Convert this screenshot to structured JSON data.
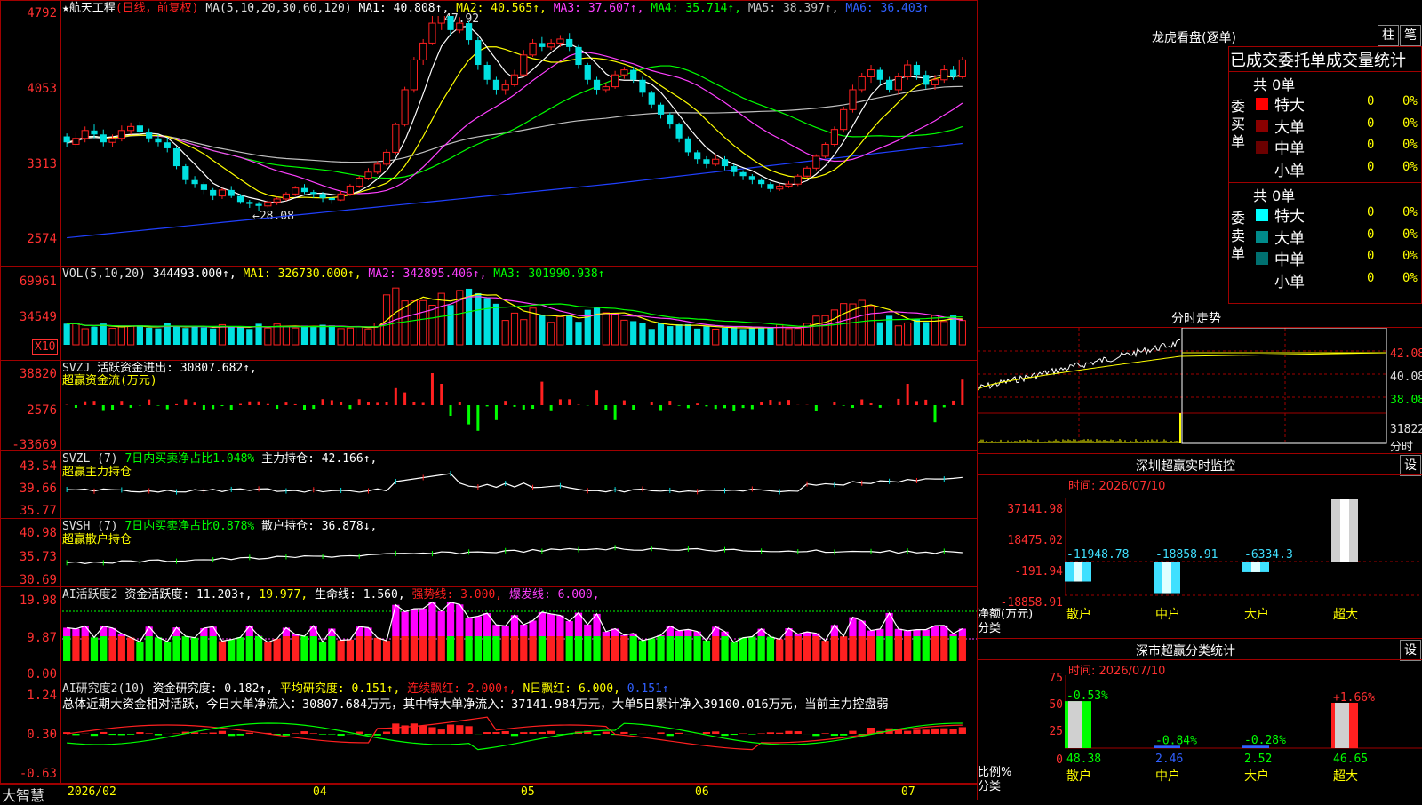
{
  "stock": {
    "star": "★",
    "name": "航天工程",
    "mode": "(日线，前复权)",
    "ma_label": "MA(5,10,20,30,60,120)",
    "ma1": "MA1: 40.808↑,",
    "ma2": "MA2: 40.565↑,",
    "ma3": "MA3: 37.607↑,",
    "ma4": "MA4: 35.714↑,",
    "ma5": "MA5: 38.397↑,",
    "ma6": "MA6: 36.403↑",
    "high_mark": "47.92",
    "low_mark": "←28.08",
    "y_labels": [
      "4792",
      "4053",
      "3313",
      "2574"
    ]
  },
  "vol": {
    "label": "VOL(5,10,20)",
    "value": "344493.000↑,",
    "ma1": "MA1: 326730.000↑,",
    "ma2": "MA2: 342895.406↑,",
    "ma3": "MA3: 301990.938↑",
    "y_labels": [
      "69961",
      "34549"
    ],
    "unit": "X10"
  },
  "svzj": {
    "label": "SVZJ",
    "text": "活跃资金进出: 30807.682↑,",
    "subtitle": "超赢资金流(万元)",
    "y_labels": [
      "38820",
      "2576",
      "-33669"
    ]
  },
  "svzl": {
    "label": "SVZL (7)",
    "ratio": "7日内买卖净占比1.048%",
    "hold": "主力持仓: 42.166↑,",
    "subtitle": "超赢主力持仓",
    "y_labels": [
      "43.54",
      "39.66",
      "35.77"
    ]
  },
  "svsh": {
    "label": "SVSH (7)",
    "ratio": "7日内买卖净占比0.878%",
    "hold": "散户持仓: 36.878↓,",
    "subtitle": "超赢散户持仓",
    "y_labels": [
      "40.98",
      "35.73",
      "30.69"
    ]
  },
  "ai1": {
    "label": "AI活跃度2",
    "text": "资金活跃度: 11.203↑,",
    "v2": "19.977,",
    "life": "生命线: 1.560,",
    "strong": "强势线: 3.000,",
    "burst": "爆发线: 6.000,",
    "y_labels": [
      "19.98",
      "9.87",
      "0.00"
    ]
  },
  "ai2": {
    "label": "AI研究度2(10)",
    "text": "资金研究度: 0.182↑,",
    "avg": "平均研究度: 0.151↑,",
    "lx": "连续飘红: 2.000↑,",
    "nday": "N日飘红: 6.000,",
    "tail": "0.151↑",
    "summary": "总体近期大资金相对活跃，今日大单净流入：30807.684万元，其中特大单净流入：37141.984万元，大单5日累计净入39100.016万元，当前主力控盘弱",
    "y_labels": [
      "1.24",
      "0.30",
      "-0.63"
    ]
  },
  "footer": {
    "brand": "大智慧",
    "dates": [
      "2026/02",
      "04",
      "05",
      "06",
      "07"
    ]
  },
  "right": {
    "title": "龙虎看盘(逐单)",
    "btn1": "柱",
    "btn2": "笔",
    "table_header": "已成交委托单成交量统计",
    "buy_title": "委买单",
    "sell_title": "委卖单",
    "buy_total": "共 0单",
    "sell_total": "共 0单",
    "buy_rows": [
      {
        "name": "特大",
        "count": "0",
        "pct": "0%",
        "color": "#ff0000"
      },
      {
        "name": "大单",
        "count": "0",
        "pct": "0%",
        "color": "#8b0000"
      },
      {
        "name": "中单",
        "count": "0",
        "pct": "0%",
        "color": "#6b0000"
      },
      {
        "name": "小单",
        "count": "0",
        "pct": "0%",
        "color": "#000000"
      }
    ],
    "sell_rows": [
      {
        "name": "特大",
        "count": "0",
        "pct": "0%",
        "color": "#00ffff"
      },
      {
        "name": "大单",
        "count": "0",
        "pct": "0%",
        "color": "#008b8b"
      },
      {
        "name": "中单",
        "count": "0",
        "pct": "0%",
        "color": "#007070"
      },
      {
        "name": "小单",
        "count": "0",
        "pct": "0%",
        "color": "#000000"
      }
    ],
    "intraday_title": "分时走势",
    "intraday_y": [
      "42.08",
      "40.08",
      "38.08",
      "31822"
    ],
    "intraday_unit": "分时",
    "monitor_title": "深圳超赢实时监控",
    "monitor_btn": "设",
    "monitor_time": "时间: 2026/07/10",
    "monitor_y": [
      "37141.98",
      "18475.02",
      "-191.94",
      "-18858.91"
    ],
    "monitor_axis": [
      "净额(万元)",
      "分类"
    ],
    "monitor_cats": [
      "散户",
      "中户",
      "大户",
      "超大"
    ],
    "monitor_vals": [
      "-11948.78",
      "-18858.91",
      "-6334.3",
      "37141.98"
    ],
    "class_title": "深市超赢分类统计",
    "class_btn": "设",
    "class_time": "时间: 2026/07/10",
    "class_y": [
      "75",
      "50",
      "25",
      "0"
    ],
    "class_axis": [
      "比例%",
      "分类"
    ],
    "class_cats": [
      "散户",
      "中户",
      "大户",
      "超大"
    ],
    "class_top": [
      "-0.53%",
      "-0.84%",
      "-0.28%",
      "+1.66%"
    ],
    "class_vals": [
      "48.38",
      "2.46",
      "2.52",
      "46.65"
    ]
  },
  "chart_data": {
    "type": "candlestick",
    "candles": [
      [
        3580,
        3520,
        3610,
        3470
      ],
      [
        3500,
        3560,
        3620,
        3460
      ],
      [
        3560,
        3640,
        3680,
        3520
      ],
      [
        3640,
        3600,
        3700,
        3560
      ],
      [
        3600,
        3520,
        3650,
        3480
      ],
      [
        3520,
        3560,
        3600,
        3470
      ],
      [
        3560,
        3640,
        3690,
        3530
      ],
      [
        3640,
        3680,
        3720,
        3600
      ],
      [
        3690,
        3620,
        3730,
        3580
      ],
      [
        3620,
        3560,
        3660,
        3520
      ],
      [
        3560,
        3520,
        3600,
        3480
      ],
      [
        3520,
        3460,
        3570,
        3420
      ],
      [
        3460,
        3280,
        3480,
        3250
      ],
      [
        3280,
        3140,
        3300,
        3100
      ],
      [
        3140,
        3100,
        3180,
        3060
      ],
      [
        3100,
        3040,
        3120,
        3000
      ],
      [
        3040,
        2980,
        3060,
        2940
      ],
      [
        2980,
        3040,
        3060,
        2950
      ],
      [
        3040,
        2980,
        3080,
        2960
      ],
      [
        2980,
        2920,
        3000,
        2900
      ],
      [
        2920,
        2900,
        2940,
        2860
      ],
      [
        2900,
        2880,
        2920,
        2830
      ],
      [
        2880,
        2920,
        2940,
        2860
      ],
      [
        2920,
        2950,
        2970,
        2890
      ],
      [
        2950,
        3000,
        3020,
        2930
      ],
      [
        3000,
        3060,
        3080,
        2980
      ],
      [
        3060,
        3020,
        3100,
        3000
      ],
      [
        3020,
        3000,
        3040,
        2960
      ],
      [
        3000,
        2960,
        3020,
        2920
      ],
      [
        2960,
        2940,
        2980,
        2900
      ],
      [
        2940,
        3000,
        3030,
        2930
      ],
      [
        3000,
        3080,
        3100,
        2980
      ],
      [
        3080,
        3160,
        3180,
        3060
      ],
      [
        3160,
        3220,
        3260,
        3140
      ],
      [
        3220,
        3300,
        3330,
        3200
      ],
      [
        3300,
        3420,
        3450,
        3280
      ],
      [
        3420,
        3700,
        3720,
        3400
      ],
      [
        3700,
        4050,
        4080,
        3680
      ],
      [
        4050,
        4350,
        4380,
        4020
      ],
      [
        4350,
        4520,
        4560,
        4300
      ],
      [
        4520,
        4720,
        4792,
        4500
      ],
      [
        4720,
        4800,
        4792,
        4650
      ],
      [
        4800,
        4650,
        4792,
        4600
      ],
      [
        4650,
        4720,
        4780,
        4620
      ],
      [
        4720,
        4550,
        4740,
        4500
      ],
      [
        4550,
        4300,
        4580,
        4250
      ],
      [
        4300,
        4150,
        4330,
        4100
      ],
      [
        4150,
        4050,
        4180,
        4000
      ],
      [
        4050,
        4100,
        4150,
        4000
      ],
      [
        4100,
        4200,
        4250,
        4080
      ],
      [
        4200,
        4400,
        4450,
        4180
      ],
      [
        4400,
        4520,
        4560,
        4380
      ],
      [
        4520,
        4480,
        4580,
        4440
      ],
      [
        4480,
        4520,
        4560,
        4450
      ],
      [
        4520,
        4560,
        4600,
        4480
      ],
      [
        4560,
        4480,
        4620,
        4440
      ],
      [
        4480,
        4300,
        4500,
        4260
      ],
      [
        4300,
        4150,
        4320,
        4100
      ],
      [
        4150,
        4050,
        4180,
        4000
      ],
      [
        4050,
        4080,
        4120,
        4020
      ],
      [
        4080,
        4200,
        4240,
        4060
      ],
      [
        4200,
        4250,
        4280,
        4160
      ],
      [
        4250,
        4150,
        4280,
        4120
      ],
      [
        4150,
        4020,
        4180,
        3980
      ],
      [
        4020,
        3900,
        4040,
        3860
      ],
      [
        3900,
        3800,
        3920,
        3760
      ],
      [
        3800,
        3700,
        3820,
        3660
      ],
      [
        3700,
        3560,
        3720,
        3520
      ],
      [
        3560,
        3420,
        3580,
        3380
      ],
      [
        3420,
        3350,
        3440,
        3300
      ],
      [
        3350,
        3300,
        3380,
        3260
      ],
      [
        3300,
        3350,
        3400,
        3280
      ],
      [
        3350,
        3280,
        3380,
        3240
      ],
      [
        3280,
        3220,
        3300,
        3180
      ],
      [
        3220,
        3180,
        3240,
        3140
      ],
      [
        3180,
        3140,
        3200,
        3100
      ],
      [
        3140,
        3100,
        3160,
        3060
      ],
      [
        3100,
        3050,
        3120,
        3020
      ],
      [
        3050,
        3080,
        3100,
        3030
      ],
      [
        3080,
        3100,
        3130,
        3060
      ],
      [
        3100,
        3180,
        3200,
        3080
      ],
      [
        3180,
        3260,
        3280,
        3160
      ],
      [
        3260,
        3380,
        3400,
        3240
      ],
      [
        3380,
        3500,
        3520,
        3360
      ],
      [
        3500,
        3650,
        3680,
        3480
      ],
      [
        3650,
        3850,
        3880,
        3620
      ],
      [
        3850,
        4050,
        4100,
        3820
      ],
      [
        4050,
        4180,
        4220,
        4020
      ],
      [
        4180,
        4250,
        4300,
        4120
      ],
      [
        4250,
        4150,
        4280,
        4100
      ],
      [
        4150,
        4050,
        4180,
        4020
      ],
      [
        4050,
        4180,
        4220,
        4000
      ],
      [
        4180,
        4300,
        4350,
        4150
      ],
      [
        4300,
        4200,
        4330,
        4150
      ],
      [
        4200,
        4100,
        4240,
        4060
      ],
      [
        4100,
        4150,
        4200,
        4050
      ],
      [
        4150,
        4250,
        4300,
        4120
      ],
      [
        4250,
        4180,
        4290,
        4150
      ],
      [
        4180,
        4350,
        4380,
        4160
      ]
    ]
  }
}
